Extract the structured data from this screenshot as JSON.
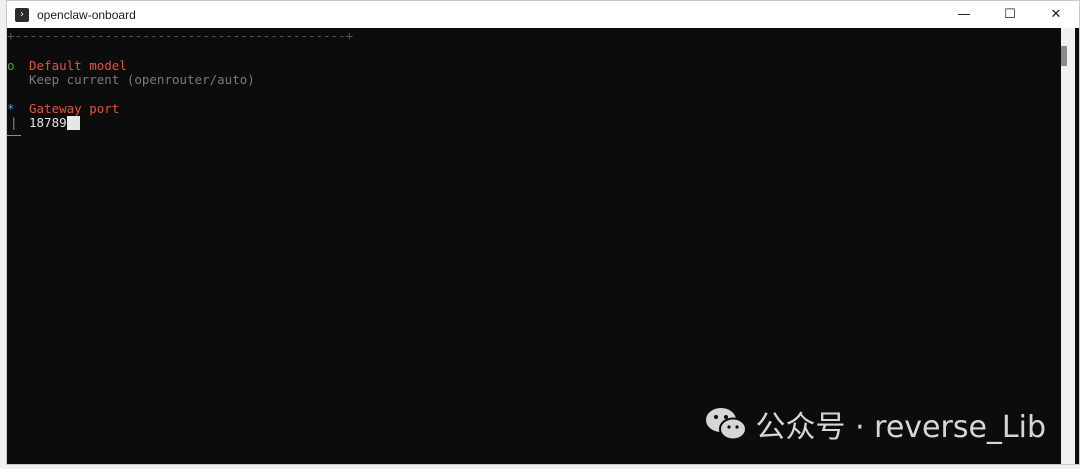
{
  "window": {
    "title": "openclaw-onboard",
    "app_icon": "powershell-icon",
    "controls": {
      "minimize": "—",
      "maximize": "☐",
      "close": "✕"
    }
  },
  "terminal": {
    "border_line": "+--------------------------------------------+",
    "steps": [
      {
        "bullet": "o",
        "label": "Default model",
        "value": "Keep current (openrouter/auto)"
      },
      {
        "bullet": "*",
        "label": "Gateway port",
        "input_value": "18789",
        "bar": "|"
      }
    ]
  },
  "watermark": {
    "text": "公众号 · reverse_Lib"
  },
  "colors": {
    "terminal_bg": "#0c0c0c",
    "label": "#e5533d",
    "muted": "#7a7a7a",
    "success": "#3fae3f",
    "active": "#4b9fe0"
  }
}
